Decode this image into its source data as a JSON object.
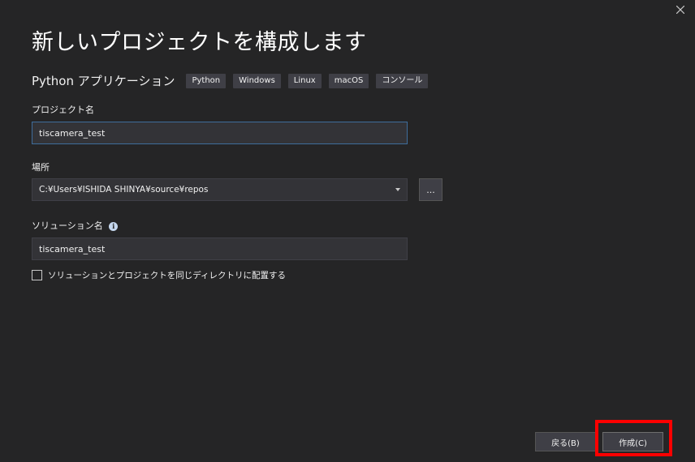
{
  "dialog": {
    "title": "新しいプロジェクトを構成します",
    "close_icon": "close-icon"
  },
  "template": {
    "name": "Python アプリケーション",
    "tags": [
      "Python",
      "Windows",
      "Linux",
      "macOS",
      "コンソール"
    ]
  },
  "project_name": {
    "label": "プロジェクト名",
    "value": "tiscamera_test"
  },
  "location": {
    "label": "場所",
    "value": "C:¥Users¥ISHIDA SHINYA¥source¥repos",
    "browse_label": "..."
  },
  "solution_name": {
    "label": "ソリューション名",
    "value": "tiscamera_test",
    "info_glyph": "i"
  },
  "same_directory": {
    "label": "ソリューションとプロジェクトを同じディレクトリに配置する",
    "checked": false
  },
  "buttons": {
    "back_label": "戻る(B)",
    "create_label": "作成(C)"
  },
  "colors": {
    "background": "#252526",
    "input_background": "#333337",
    "focus_border": "#3e6d9c",
    "highlight": "#ff0000"
  }
}
